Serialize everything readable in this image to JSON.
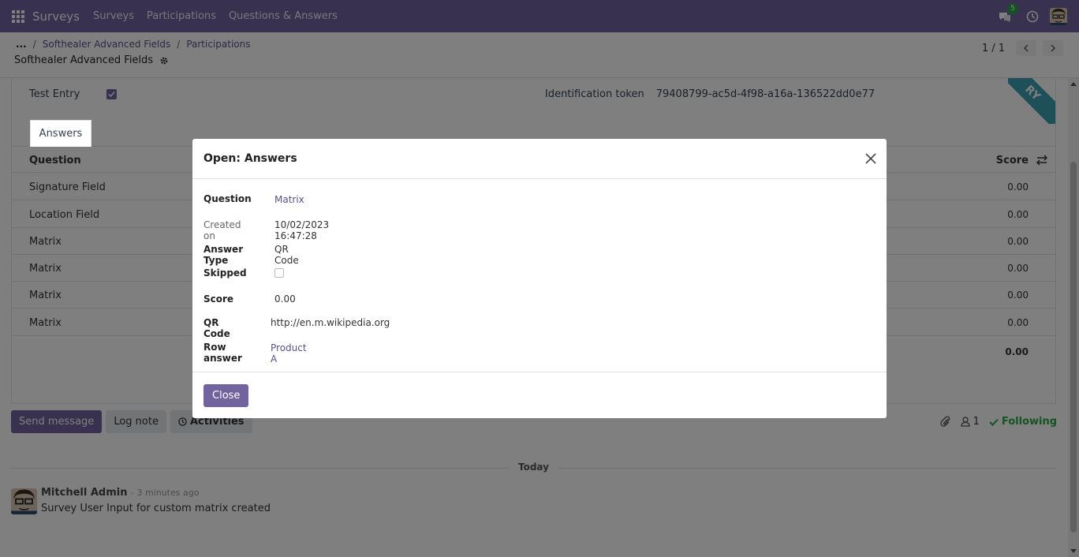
{
  "navbar": {
    "brand": "Surveys",
    "menu": [
      "Surveys",
      "Participations",
      "Questions & Answers"
    ],
    "chat_count": "5"
  },
  "control_panel": {
    "breadcrumb_ellipsis": "...",
    "breadcrumb": [
      "Softhealer Advanced Fields",
      "Participations"
    ],
    "record_title": "Softhealer Advanced Fields",
    "pager": "1 / 1"
  },
  "form": {
    "ribbon_text": "RY",
    "test_entry_label": "Test Entry",
    "token_label": "Identification token",
    "token_value": "79408799-ac5d-4f98-a16a-136522dd0e77",
    "tab_label": "Answers",
    "columns": {
      "question": "Question",
      "score": "Score"
    },
    "rows": [
      {
        "question": "Signature Field",
        "score": "0.00"
      },
      {
        "question": "Location Field",
        "score": "0.00"
      },
      {
        "question": "Matrix",
        "score": "0.00"
      },
      {
        "question": "Matrix",
        "score": "0.00"
      },
      {
        "question": "Matrix",
        "score": "0.00"
      },
      {
        "question": "Matrix",
        "score": "0.00"
      }
    ],
    "total": "0.00"
  },
  "chatter": {
    "send_message": "Send message",
    "log_note": "Log note",
    "activities": "Activities",
    "followers_count": "1",
    "following": "Following",
    "today": "Today",
    "message": {
      "author": "Mitchell Admin",
      "time": "- 3 minutes ago",
      "body": "Survey User Input for custom matrix created"
    }
  },
  "modal": {
    "title": "Open: Answers",
    "fields": {
      "question_label": "Question",
      "question_value": "Matrix",
      "created_label": "Created on",
      "created_value": "10/02/2023 16:47:28",
      "answer_type_label": "Answer Type",
      "answer_type_value": "QR Code",
      "skipped_label": "Skipped",
      "score_label": "Score",
      "score_value": "0.00",
      "qr_label": "QR Code",
      "qr_value": "http://en.m.wikipedia.org",
      "row_answer_label": "Row answer",
      "row_answer_value": "Product A"
    },
    "close_label": "Close"
  },
  "colors": {
    "brand": "#71639e",
    "link": "#5a4f8a",
    "success": "#28a745",
    "ribbon": "#3aa0b3"
  }
}
